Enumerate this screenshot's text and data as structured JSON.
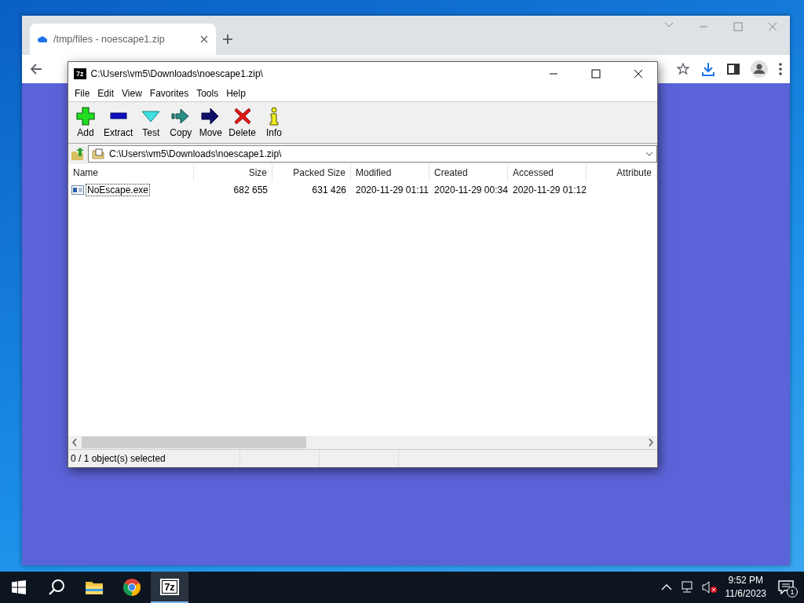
{
  "browser": {
    "tabs": [
      {
        "title": "/tmp/files - noescape1.zip",
        "selected": true
      }
    ]
  },
  "archive_window": {
    "logo": "7z",
    "title": "C:\\Users\\vm5\\Downloads\\noescape1.zip\\",
    "menu": [
      "File",
      "Edit",
      "View",
      "Favorites",
      "Tools",
      "Help"
    ],
    "toolbar": [
      {
        "label": "Add",
        "kind": "add"
      },
      {
        "label": "Extract",
        "kind": "extract"
      },
      {
        "label": "Test",
        "kind": "test"
      },
      {
        "label": "Copy",
        "kind": "copy"
      },
      {
        "label": "Move",
        "kind": "move"
      },
      {
        "label": "Delete",
        "kind": "delete"
      },
      {
        "label": "Info",
        "kind": "info"
      }
    ],
    "path": "C:\\Users\\vm5\\Downloads\\noescape1.zip\\",
    "columns": [
      "Name",
      "Size",
      "Packed Size",
      "Modified",
      "Created",
      "Accessed",
      "Attribute"
    ],
    "rows": [
      {
        "cells": [
          "NoEscape.exe",
          "682 655",
          "631 426",
          "2020-11-29 01:11",
          "2020-11-29 00:34",
          "2020-11-29 01:12"
        ],
        "focused": true
      }
    ],
    "status": [
      "0 / 1 object(s) selected"
    ]
  },
  "taskbar": {
    "apps": [
      {
        "kind": "explorer",
        "active": false
      },
      {
        "kind": "chrome",
        "active": false
      },
      {
        "kind": "archiver",
        "label": "7z",
        "active": true
      }
    ],
    "time": "9:52 PM",
    "date": "11/6/2023",
    "notifications": "1"
  }
}
